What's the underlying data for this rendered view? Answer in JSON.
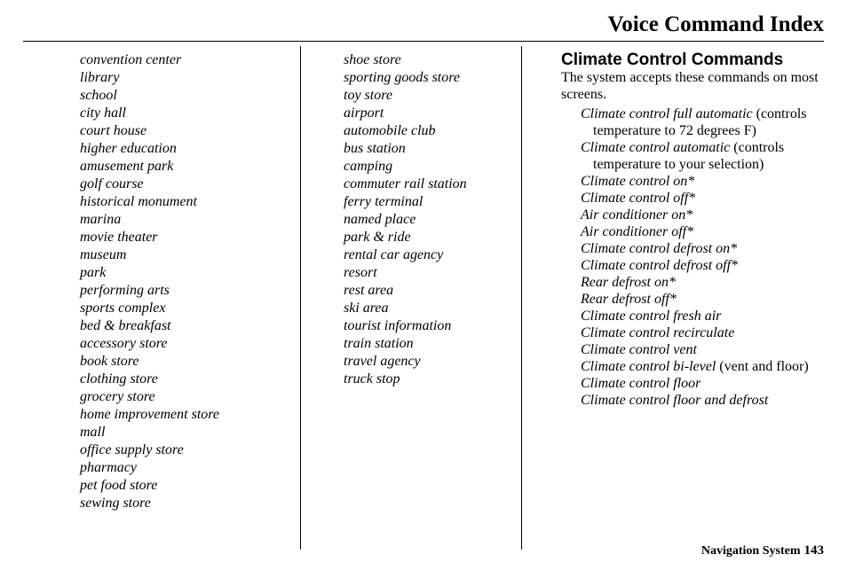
{
  "page_title": "Voice Command Index",
  "col1": [
    "convention center",
    "library",
    "school",
    "city hall",
    "court house",
    "higher education",
    "amusement park",
    "golf course",
    "historical monument",
    "marina",
    "movie theater",
    "museum",
    "park",
    "performing arts",
    "sports complex",
    "bed & breakfast",
    "accessory store",
    "book store",
    "clothing store",
    "grocery store",
    "home improvement store",
    "mall",
    "office supply store",
    "pharmacy",
    "pet food store",
    "sewing store"
  ],
  "col2": [
    "shoe store",
    "sporting goods store",
    "toy store",
    "airport",
    "automobile club",
    "bus station",
    "camping",
    "commuter rail station",
    "ferry terminal",
    "named place",
    "park & ride",
    "rental car agency",
    "resort",
    "rest area",
    "ski area",
    "tourist information",
    "train station",
    "travel agency",
    "truck stop"
  ],
  "climate": {
    "title": "Climate Control Commands",
    "intro": "The system accepts these commands on most screens.",
    "items": [
      {
        "em": "Climate control full automatic",
        "rest": " (controls temperature to 72 degrees F)"
      },
      {
        "em": "Climate control automatic",
        "rest": " (controls temperature to your selection)"
      },
      {
        "em": "Climate control on*",
        "rest": ""
      },
      {
        "em": "Climate control off*",
        "rest": ""
      },
      {
        "em": "Air conditioner on*",
        "rest": ""
      },
      {
        "em": "Air conditioner off*",
        "rest": ""
      },
      {
        "em": "Climate control defrost on*",
        "rest": ""
      },
      {
        "em": "Climate control defrost off*",
        "rest": ""
      },
      {
        "em": "Rear defrost on*",
        "rest": ""
      },
      {
        "em": "Rear defrost off*",
        "rest": ""
      },
      {
        "em": "Climate control fresh air",
        "rest": ""
      },
      {
        "em": "Climate control recirculate",
        "rest": ""
      },
      {
        "em": "Climate control vent",
        "rest": ""
      },
      {
        "em": "Climate control bi-level",
        "rest": " (vent and floor)"
      },
      {
        "em": "Climate control floor",
        "rest": ""
      },
      {
        "em": "Climate control floor and defrost",
        "rest": ""
      }
    ]
  },
  "footer": {
    "label": "Navigation System",
    "page": "143"
  }
}
